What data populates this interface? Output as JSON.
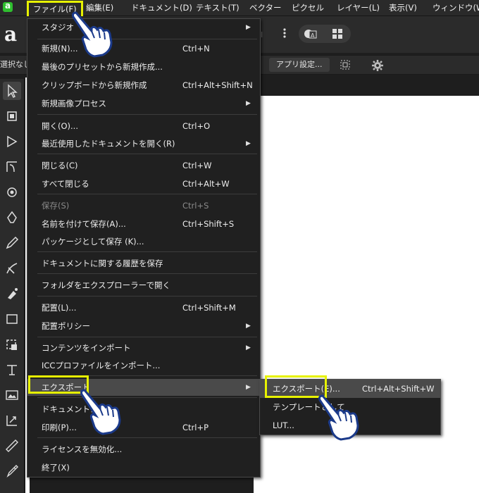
{
  "menubar": {
    "items": [
      "ファイル(F)",
      "編集(E)",
      "ドキュメント(D)",
      "テキスト(T)",
      "ベクター",
      "ピクセル",
      "レイヤー(L)",
      "表示(V)",
      "ウィンドウ(W)"
    ]
  },
  "toolbar": {
    "app_glyph": "a",
    "selection_label": "選択なし",
    "app_settings_label": "アプリ設定..."
  },
  "file_menu": {
    "items": [
      {
        "label": "スタジオ",
        "shortcut": "",
        "submenu": true
      },
      {
        "label": "新規(N)...",
        "shortcut": "Ctrl+N"
      },
      {
        "label": "最後のプリセットから新規作成...",
        "shortcut": ""
      },
      {
        "label": "クリップボードから新規作成",
        "shortcut": "Ctrl+Alt+Shift+N"
      },
      {
        "label": "新規画像プロセス",
        "shortcut": "",
        "submenu": true
      },
      {
        "label": "開く(O)...",
        "shortcut": "Ctrl+O"
      },
      {
        "label": "最近使用したドキュメントを開く(R)",
        "shortcut": "",
        "submenu": true
      },
      {
        "label": "閉じる(C)",
        "shortcut": "Ctrl+W"
      },
      {
        "label": "すべて閉じる",
        "shortcut": "Ctrl+Alt+W"
      },
      {
        "label": "保存(S)",
        "shortcut": "Ctrl+S",
        "disabled": true
      },
      {
        "label": "名前を付けて保存(A)...",
        "shortcut": "Ctrl+Shift+S"
      },
      {
        "label": "パッケージとして保存 (K)...",
        "shortcut": ""
      },
      {
        "label": "ドキュメントに関する履歴を保存",
        "shortcut": ""
      },
      {
        "label": "フォルダをエクスプローラーで開く",
        "shortcut": ""
      },
      {
        "label": "配置(L)...",
        "shortcut": "Ctrl+Shift+M"
      },
      {
        "label": "配置ポリシー",
        "shortcut": "",
        "submenu": true
      },
      {
        "label": "コンテンツをインポート",
        "shortcut": "",
        "submenu": true
      },
      {
        "label": "ICCプロファイルをインポート...",
        "shortcut": ""
      },
      {
        "label": "エクスポート",
        "shortcut": "",
        "submenu": true
      },
      {
        "label": "ドキュメントメタ",
        "shortcut": ""
      },
      {
        "label": "印刷(P)...",
        "shortcut": "Ctrl+P"
      },
      {
        "label": "ライセンスを無効化...",
        "shortcut": ""
      },
      {
        "label": "終了(X)",
        "shortcut": ""
      }
    ]
  },
  "export_submenu": {
    "items": [
      {
        "label": "エクスポート(E)...",
        "shortcut": "Ctrl+Alt+Shift+W"
      },
      {
        "label": "テンプレートとして",
        "shortcut": ""
      },
      {
        "label": "LUT...",
        "shortcut": ""
      }
    ]
  },
  "colors": {
    "highlight": "#e7f200",
    "brand": "#2fbf2f",
    "menu_bg": "#202020",
    "hover_bg": "#4a4a4a"
  },
  "icons": [
    "app-logo-icon",
    "pointer-icon",
    "crop-icon",
    "node-icon",
    "corner-icon",
    "gear-icon",
    "pen-icon",
    "pencil-icon",
    "brush-icon",
    "fill-icon",
    "rectangle-icon",
    "shape-icon",
    "text-icon",
    "image-icon",
    "transform-icon",
    "ruler-icon",
    "eyedropper-icon",
    "hand-pointer-icon"
  ]
}
